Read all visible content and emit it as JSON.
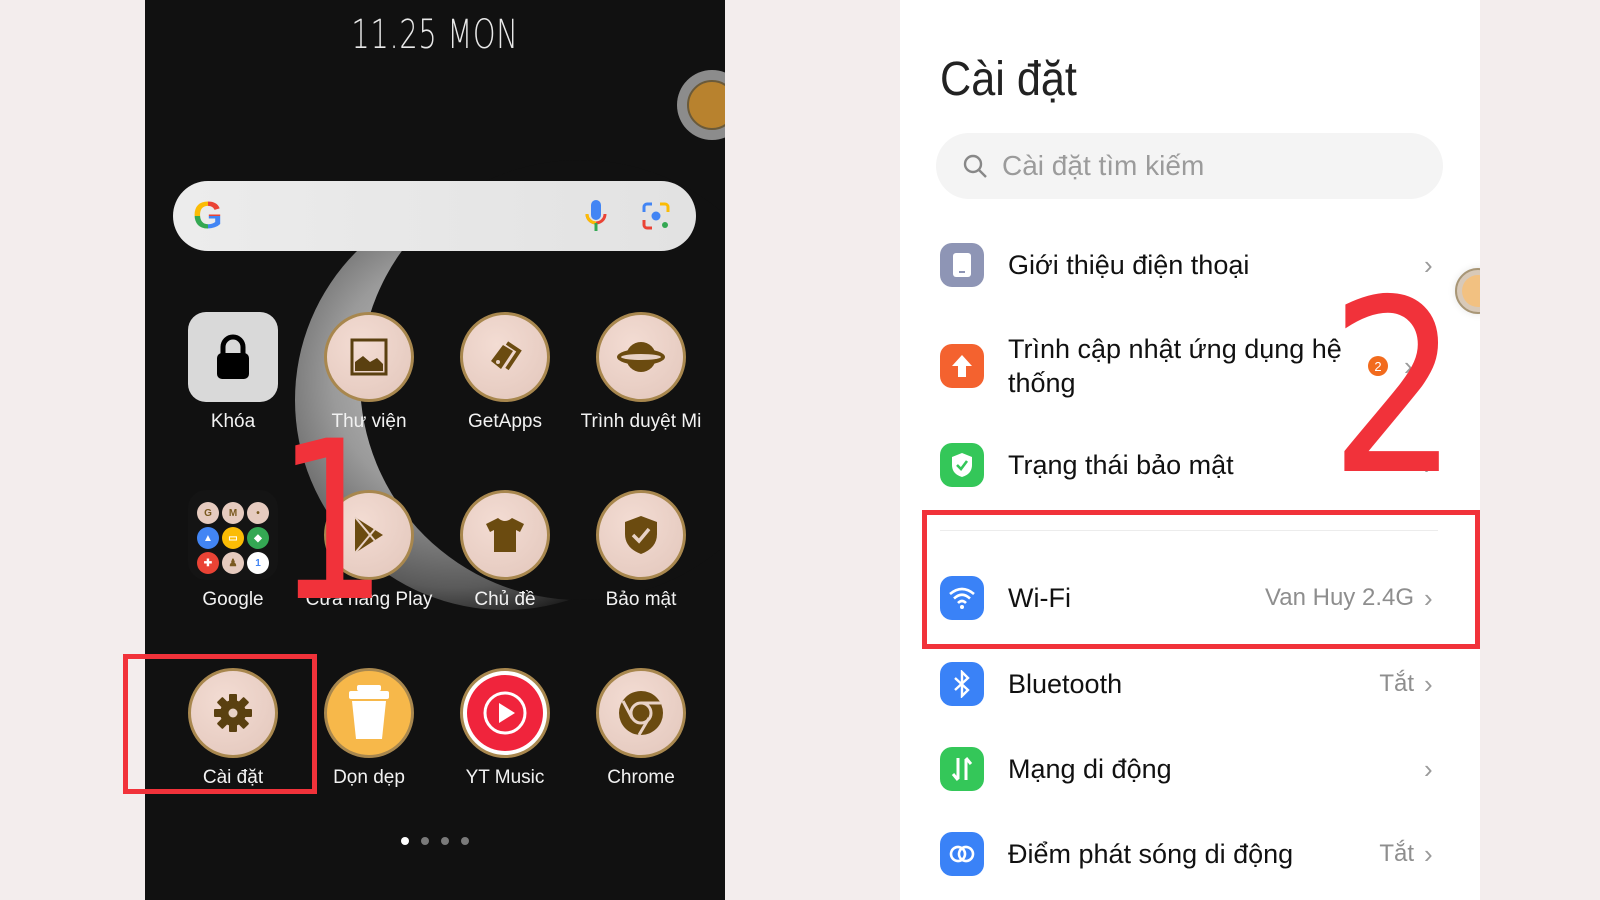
{
  "home_screen": {
    "date_text": "11.25 MON",
    "search_bar": {
      "logo": "G",
      "mic_icon": "microphone-icon",
      "lens_icon": "google-lens-icon"
    },
    "apps": [
      {
        "label": "Khóa",
        "icon": "lock-icon"
      },
      {
        "label": "Thư viện",
        "icon": "gallery-icon"
      },
      {
        "label": "GetApps",
        "icon": "getapps-tag-icon"
      },
      {
        "label": "Trình duyệt Mi",
        "icon": "planet-browser-icon"
      },
      {
        "label": "Google",
        "icon": "google-folder-icon"
      },
      {
        "label": "Cửa hàng Play",
        "icon": "play-store-icon"
      },
      {
        "label": "Chủ đề",
        "icon": "tshirt-theme-icon"
      },
      {
        "label": "Bảo mật",
        "icon": "security-shield-icon"
      },
      {
        "label": "Cài đặt",
        "icon": "gear-icon"
      },
      {
        "label": "Dọn dẹp",
        "icon": "trash-cleaner-icon"
      },
      {
        "label": "YT Music",
        "icon": "yt-music-icon"
      },
      {
        "label": "Chrome",
        "icon": "chrome-icon"
      }
    ],
    "google_folder_letters": [
      "G",
      "M",
      "•",
      "▲",
      "▭",
      "◆",
      "✚",
      "♟",
      "1"
    ],
    "page_indicator": {
      "total": 4,
      "active": 1
    }
  },
  "settings_screen": {
    "title": "Cài đặt",
    "search_placeholder": "Cài đặt tìm kiếm",
    "items": [
      {
        "label": "Giới thiệu điện thoại",
        "value": "",
        "icon": "phone-info-icon",
        "color": "#8e95b5"
      },
      {
        "label": "Trình cập nhật ứng dụng hệ thống",
        "value": "",
        "badge": "2",
        "icon": "update-arrow-icon",
        "color": "#f4622f"
      },
      {
        "label": "Trạng thái bảo mật",
        "value": "",
        "icon": "security-check-icon",
        "color": "#34c759"
      },
      {
        "label": "Wi-Fi",
        "value": "Van Huy 2.4G",
        "icon": "wifi-icon",
        "color": "#3a82f7"
      },
      {
        "label": "Bluetooth",
        "value": "Tắt",
        "icon": "bluetooth-icon",
        "color": "#3a82f7"
      },
      {
        "label": "Mạng di động",
        "value": "",
        "icon": "mobile-data-icon",
        "color": "#34c759"
      },
      {
        "label": "Điểm phát sóng di động",
        "value": "Tắt",
        "icon": "hotspot-icon",
        "color": "#3a82f7"
      }
    ]
  },
  "annotations": {
    "step1": "1",
    "step2": "2",
    "highlight_color": "#f1323a"
  }
}
